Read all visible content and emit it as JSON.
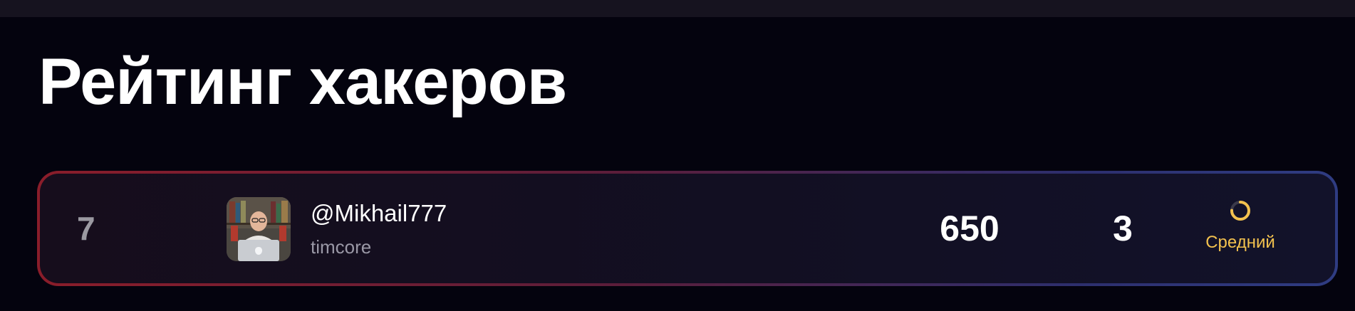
{
  "page": {
    "title": "Рейтинг хакеров"
  },
  "rating": {
    "rows": [
      {
        "rank": "7",
        "avatar": "user-photo",
        "username": "@Mikhail777",
        "team": "timcore",
        "score": "650",
        "solved": "3",
        "level": {
          "label": "Средний",
          "icon": "progress-ring-icon",
          "fill_fraction": 0.75,
          "color": "#f2c14e"
        }
      }
    ]
  },
  "colors": {
    "background": "#04030e",
    "top_bar": "#16131f",
    "card_border_start": "#8a1d2a",
    "card_border_end": "#2f3c82",
    "level_accent": "#f2c14e",
    "muted_text": "#9a98a6"
  }
}
